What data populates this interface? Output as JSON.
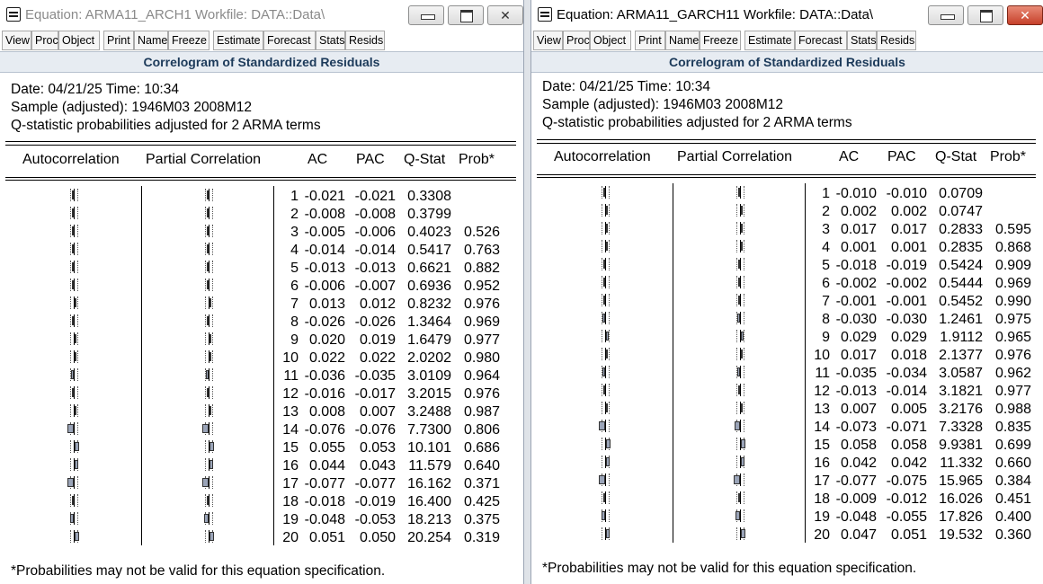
{
  "windows": [
    {
      "id": "left",
      "title": "Equation: ARMA11_ARCH1   Workfile: DATA::Data\\",
      "active": false,
      "toolbar": [
        "View",
        "Proc",
        "Object",
        "Print",
        "Name",
        "Freeze",
        "Estimate",
        "Forecast",
        "Stats",
        "Resids"
      ],
      "heading": "Correlogram of Standardized Residuals",
      "date_line": "Date: 04/21/25   Time: 10:34",
      "sample_line": "Sample (adjusted): 1946M03 2008M12",
      "qstat_note": "Q-statistic probabilities adjusted for 2 ARMA terms",
      "columns": {
        "autocorrelation": "Autocorrelation",
        "partial": "Partial Correlation",
        "ac": "AC",
        "pac": "PAC",
        "qstat": "Q-Stat",
        "prob": "Prob*"
      },
      "footer": "*Probabilities may not be valid for this equation specification.",
      "rows": [
        {
          "lag": "1",
          "ac": "-0.021",
          "pac": "-0.021",
          "q": "0.3308",
          "p": ""
        },
        {
          "lag": "2",
          "ac": "-0.008",
          "pac": "-0.008",
          "q": "0.3799",
          "p": ""
        },
        {
          "lag": "3",
          "ac": "-0.005",
          "pac": "-0.006",
          "q": "0.4023",
          "p": "0.526"
        },
        {
          "lag": "4",
          "ac": "-0.014",
          "pac": "-0.014",
          "q": "0.5417",
          "p": "0.763"
        },
        {
          "lag": "5",
          "ac": "-0.013",
          "pac": "-0.013",
          "q": "0.6621",
          "p": "0.882"
        },
        {
          "lag": "6",
          "ac": "-0.006",
          "pac": "-0.007",
          "q": "0.6936",
          "p": "0.952"
        },
        {
          "lag": "7",
          "ac": "0.013",
          "pac": "0.012",
          "q": "0.8232",
          "p": "0.976"
        },
        {
          "lag": "8",
          "ac": "-0.026",
          "pac": "-0.026",
          "q": "1.3464",
          "p": "0.969"
        },
        {
          "lag": "9",
          "ac": "0.020",
          "pac": "0.019",
          "q": "1.6479",
          "p": "0.977"
        },
        {
          "lag": "10",
          "ac": "0.022",
          "pac": "0.022",
          "q": "2.0202",
          "p": "0.980"
        },
        {
          "lag": "11",
          "ac": "-0.036",
          "pac": "-0.035",
          "q": "3.0109",
          "p": "0.964"
        },
        {
          "lag": "12",
          "ac": "-0.016",
          "pac": "-0.017",
          "q": "3.2015",
          "p": "0.976"
        },
        {
          "lag": "13",
          "ac": "0.008",
          "pac": "0.007",
          "q": "3.2488",
          "p": "0.987"
        },
        {
          "lag": "14",
          "ac": "-0.076",
          "pac": "-0.076",
          "q": "7.7300",
          "p": "0.806"
        },
        {
          "lag": "15",
          "ac": "0.055",
          "pac": "0.053",
          "q": "10.101",
          "p": "0.686"
        },
        {
          "lag": "16",
          "ac": "0.044",
          "pac": "0.043",
          "q": "11.579",
          "p": "0.640"
        },
        {
          "lag": "17",
          "ac": "-0.077",
          "pac": "-0.077",
          "q": "16.162",
          "p": "0.371"
        },
        {
          "lag": "18",
          "ac": "-0.018",
          "pac": "-0.019",
          "q": "16.400",
          "p": "0.425"
        },
        {
          "lag": "19",
          "ac": "-0.048",
          "pac": "-0.053",
          "q": "18.213",
          "p": "0.375"
        },
        {
          "lag": "20",
          "ac": "0.051",
          "pac": "0.050",
          "q": "20.254",
          "p": "0.319"
        }
      ]
    },
    {
      "id": "right",
      "title": "Equation: ARMA11_GARCH11   Workfile: DATA::Data\\",
      "active": true,
      "toolbar": [
        "View",
        "Proc",
        "Object",
        "Print",
        "Name",
        "Freeze",
        "Estimate",
        "Forecast",
        "Stats",
        "Resids"
      ],
      "heading": "Correlogram of Standardized Residuals",
      "date_line": "Date: 04/21/25   Time: 10:34",
      "sample_line": "Sample (adjusted): 1946M03 2008M12",
      "qstat_note": "Q-statistic probabilities adjusted for 2 ARMA terms",
      "columns": {
        "autocorrelation": "Autocorrelation",
        "partial": "Partial Correlation",
        "ac": "AC",
        "pac": "PAC",
        "qstat": "Q-Stat",
        "prob": "Prob*"
      },
      "footer": "*Probabilities may not be valid for this equation specification.",
      "rows": [
        {
          "lag": "1",
          "ac": "-0.010",
          "pac": "-0.010",
          "q": "0.0709",
          "p": ""
        },
        {
          "lag": "2",
          "ac": "0.002",
          "pac": "0.002",
          "q": "0.0747",
          "p": ""
        },
        {
          "lag": "3",
          "ac": "0.017",
          "pac": "0.017",
          "q": "0.2833",
          "p": "0.595"
        },
        {
          "lag": "4",
          "ac": "0.001",
          "pac": "0.001",
          "q": "0.2835",
          "p": "0.868"
        },
        {
          "lag": "5",
          "ac": "-0.018",
          "pac": "-0.019",
          "q": "0.5424",
          "p": "0.909"
        },
        {
          "lag": "6",
          "ac": "-0.002",
          "pac": "-0.002",
          "q": "0.5444",
          "p": "0.969"
        },
        {
          "lag": "7",
          "ac": "-0.001",
          "pac": "-0.001",
          "q": "0.5452",
          "p": "0.990"
        },
        {
          "lag": "8",
          "ac": "-0.030",
          "pac": "-0.030",
          "q": "1.2461",
          "p": "0.975"
        },
        {
          "lag": "9",
          "ac": "0.029",
          "pac": "0.029",
          "q": "1.9112",
          "p": "0.965"
        },
        {
          "lag": "10",
          "ac": "0.017",
          "pac": "0.018",
          "q": "2.1377",
          "p": "0.976"
        },
        {
          "lag": "11",
          "ac": "-0.035",
          "pac": "-0.034",
          "q": "3.0587",
          "p": "0.962"
        },
        {
          "lag": "12",
          "ac": "-0.013",
          "pac": "-0.014",
          "q": "3.1821",
          "p": "0.977"
        },
        {
          "lag": "13",
          "ac": "0.007",
          "pac": "0.005",
          "q": "3.2176",
          "p": "0.988"
        },
        {
          "lag": "14",
          "ac": "-0.073",
          "pac": "-0.071",
          "q": "7.3328",
          "p": "0.835"
        },
        {
          "lag": "15",
          "ac": "0.058",
          "pac": "0.058",
          "q": "9.9381",
          "p": "0.699"
        },
        {
          "lag": "16",
          "ac": "0.042",
          "pac": "0.042",
          "q": "11.332",
          "p": "0.660"
        },
        {
          "lag": "17",
          "ac": "-0.077",
          "pac": "-0.075",
          "q": "15.965",
          "p": "0.384"
        },
        {
          "lag": "18",
          "ac": "-0.009",
          "pac": "-0.012",
          "q": "16.026",
          "p": "0.451"
        },
        {
          "lag": "19",
          "ac": "-0.048",
          "pac": "-0.055",
          "q": "17.826",
          "p": "0.400"
        },
        {
          "lag": "20",
          "ac": "0.047",
          "pac": "0.051",
          "q": "19.532",
          "p": "0.360"
        }
      ]
    }
  ],
  "colors": {
    "heading_bg": "#e7ecf2",
    "heading_text": "#1c3a5a",
    "bar_fill": "#9aa4b8",
    "close_active": "#c6402a"
  },
  "icons": {
    "app": "equation-window-icon",
    "minimize": "minimize-icon",
    "maximize": "maximize-icon",
    "close": "close-icon"
  }
}
